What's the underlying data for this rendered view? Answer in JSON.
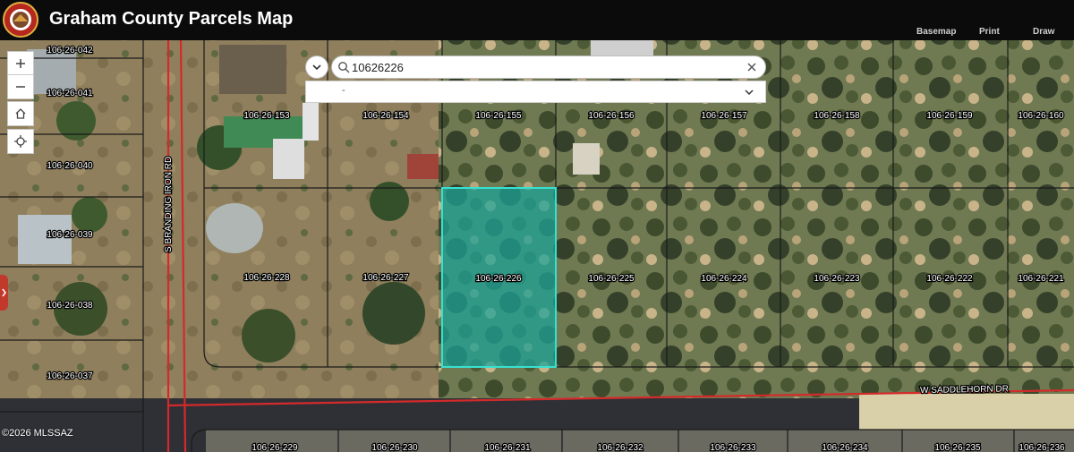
{
  "header": {
    "title": "Graham County Parcels Map",
    "links": [
      "Basemap",
      "Print",
      "Draw"
    ]
  },
  "search": {
    "value": "10626226",
    "placeholder": ""
  },
  "layer_select": {
    "value": "-"
  },
  "colors": {
    "parcel_line": "#1a1a1a",
    "road_line": "#d42a2a",
    "selected_fill": "#1aa39a",
    "selected_stroke": "#38e0d0",
    "header_bg": "#0b0b0b"
  },
  "parcels": [
    {
      "id": "106-26-042"
    },
    {
      "id": "106-26-041"
    },
    {
      "id": "106-26-040"
    },
    {
      "id": "106-26-039"
    },
    {
      "id": "106-26-038"
    },
    {
      "id": "106-26-037"
    },
    {
      "id": "106-26-153"
    },
    {
      "id": "106-26-154"
    },
    {
      "id": "106-26-155"
    },
    {
      "id": "106-26-156"
    },
    {
      "id": "106-26-157"
    },
    {
      "id": "106-26-158"
    },
    {
      "id": "106-26-159"
    },
    {
      "id": "106-26-160"
    },
    {
      "id": "106-26-228"
    },
    {
      "id": "106-26-227"
    },
    {
      "id": "106-26-226",
      "selected": true
    },
    {
      "id": "106-26-225"
    },
    {
      "id": "106-26-224"
    },
    {
      "id": "106-26-223"
    },
    {
      "id": "106-26-222"
    },
    {
      "id": "106-26-221"
    },
    {
      "id": "106-26-229"
    },
    {
      "id": "106-26-230"
    },
    {
      "id": "106-26-231"
    },
    {
      "id": "106-26-232"
    },
    {
      "id": "106-26-233"
    },
    {
      "id": "106-26-234"
    },
    {
      "id": "106-26-235"
    },
    {
      "id": "106-26-236"
    }
  ],
  "streets": [
    {
      "name": "S BRANDING IRON RD"
    },
    {
      "name": "W SADDLEHORN DR"
    }
  ],
  "copyright": "©2026 MLSSAZ"
}
